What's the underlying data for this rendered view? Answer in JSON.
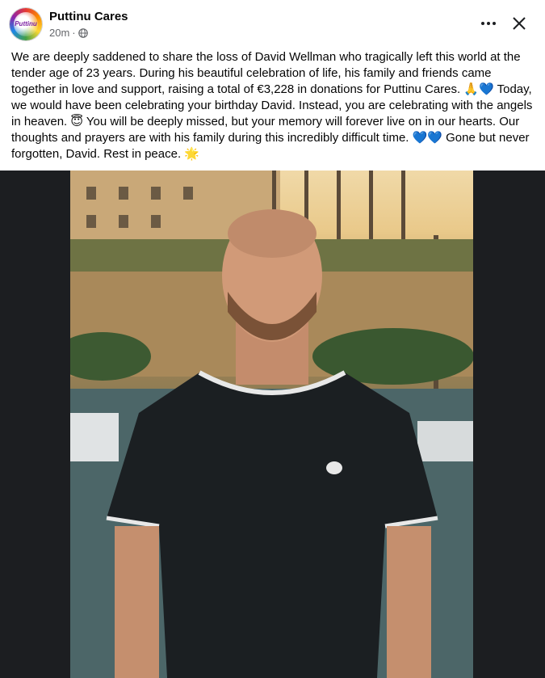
{
  "post": {
    "page_name": "Puttinu Cares",
    "avatar_text": "Puttinu",
    "time": "20m",
    "separator": "·",
    "text": "We are deeply saddened to share the loss of David Wellman who tragically left this world at the tender age of 23 years. During his beautiful celebration of life, his family and friends came together in love and support, raising a total of €3,228 in donations for Puttinu Cares. 🙏💙 Today, we would have been celebrating your birthday David. Instead, you are celebrating with the angels in heaven. 😇 You will be deeply missed, but your memory will forever live on in our hearts. Our thoughts and prayers are with his family during this incredibly difficult time. 💙💙 Gone but never forgotten, David. Rest in peace. 🌟"
  },
  "icons": {
    "privacy": "globe-icon",
    "more": "more-icon",
    "close": "close-icon"
  },
  "colors": {
    "text": "#050505",
    "meta": "#65676b",
    "photo_background": "#1c1e21"
  }
}
